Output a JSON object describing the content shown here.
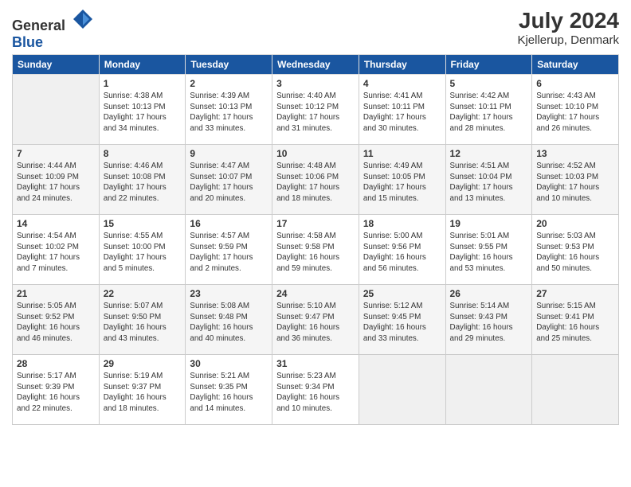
{
  "header": {
    "logo_general": "General",
    "logo_blue": "Blue",
    "title": "July 2024",
    "location": "Kjellerup, Denmark"
  },
  "days_of_week": [
    "Sunday",
    "Monday",
    "Tuesday",
    "Wednesday",
    "Thursday",
    "Friday",
    "Saturday"
  ],
  "weeks": [
    [
      {
        "day": "",
        "info": ""
      },
      {
        "day": "1",
        "info": "Sunrise: 4:38 AM\nSunset: 10:13 PM\nDaylight: 17 hours\nand 34 minutes."
      },
      {
        "day": "2",
        "info": "Sunrise: 4:39 AM\nSunset: 10:13 PM\nDaylight: 17 hours\nand 33 minutes."
      },
      {
        "day": "3",
        "info": "Sunrise: 4:40 AM\nSunset: 10:12 PM\nDaylight: 17 hours\nand 31 minutes."
      },
      {
        "day": "4",
        "info": "Sunrise: 4:41 AM\nSunset: 10:11 PM\nDaylight: 17 hours\nand 30 minutes."
      },
      {
        "day": "5",
        "info": "Sunrise: 4:42 AM\nSunset: 10:11 PM\nDaylight: 17 hours\nand 28 minutes."
      },
      {
        "day": "6",
        "info": "Sunrise: 4:43 AM\nSunset: 10:10 PM\nDaylight: 17 hours\nand 26 minutes."
      }
    ],
    [
      {
        "day": "7",
        "info": "Sunrise: 4:44 AM\nSunset: 10:09 PM\nDaylight: 17 hours\nand 24 minutes."
      },
      {
        "day": "8",
        "info": "Sunrise: 4:46 AM\nSunset: 10:08 PM\nDaylight: 17 hours\nand 22 minutes."
      },
      {
        "day": "9",
        "info": "Sunrise: 4:47 AM\nSunset: 10:07 PM\nDaylight: 17 hours\nand 20 minutes."
      },
      {
        "day": "10",
        "info": "Sunrise: 4:48 AM\nSunset: 10:06 PM\nDaylight: 17 hours\nand 18 minutes."
      },
      {
        "day": "11",
        "info": "Sunrise: 4:49 AM\nSunset: 10:05 PM\nDaylight: 17 hours\nand 15 minutes."
      },
      {
        "day": "12",
        "info": "Sunrise: 4:51 AM\nSunset: 10:04 PM\nDaylight: 17 hours\nand 13 minutes."
      },
      {
        "day": "13",
        "info": "Sunrise: 4:52 AM\nSunset: 10:03 PM\nDaylight: 17 hours\nand 10 minutes."
      }
    ],
    [
      {
        "day": "14",
        "info": "Sunrise: 4:54 AM\nSunset: 10:02 PM\nDaylight: 17 hours\nand 7 minutes."
      },
      {
        "day": "15",
        "info": "Sunrise: 4:55 AM\nSunset: 10:00 PM\nDaylight: 17 hours\nand 5 minutes."
      },
      {
        "day": "16",
        "info": "Sunrise: 4:57 AM\nSunset: 9:59 PM\nDaylight: 17 hours\nand 2 minutes."
      },
      {
        "day": "17",
        "info": "Sunrise: 4:58 AM\nSunset: 9:58 PM\nDaylight: 16 hours\nand 59 minutes."
      },
      {
        "day": "18",
        "info": "Sunrise: 5:00 AM\nSunset: 9:56 PM\nDaylight: 16 hours\nand 56 minutes."
      },
      {
        "day": "19",
        "info": "Sunrise: 5:01 AM\nSunset: 9:55 PM\nDaylight: 16 hours\nand 53 minutes."
      },
      {
        "day": "20",
        "info": "Sunrise: 5:03 AM\nSunset: 9:53 PM\nDaylight: 16 hours\nand 50 minutes."
      }
    ],
    [
      {
        "day": "21",
        "info": "Sunrise: 5:05 AM\nSunset: 9:52 PM\nDaylight: 16 hours\nand 46 minutes."
      },
      {
        "day": "22",
        "info": "Sunrise: 5:07 AM\nSunset: 9:50 PM\nDaylight: 16 hours\nand 43 minutes."
      },
      {
        "day": "23",
        "info": "Sunrise: 5:08 AM\nSunset: 9:48 PM\nDaylight: 16 hours\nand 40 minutes."
      },
      {
        "day": "24",
        "info": "Sunrise: 5:10 AM\nSunset: 9:47 PM\nDaylight: 16 hours\nand 36 minutes."
      },
      {
        "day": "25",
        "info": "Sunrise: 5:12 AM\nSunset: 9:45 PM\nDaylight: 16 hours\nand 33 minutes."
      },
      {
        "day": "26",
        "info": "Sunrise: 5:14 AM\nSunset: 9:43 PM\nDaylight: 16 hours\nand 29 minutes."
      },
      {
        "day": "27",
        "info": "Sunrise: 5:15 AM\nSunset: 9:41 PM\nDaylight: 16 hours\nand 25 minutes."
      }
    ],
    [
      {
        "day": "28",
        "info": "Sunrise: 5:17 AM\nSunset: 9:39 PM\nDaylight: 16 hours\nand 22 minutes."
      },
      {
        "day": "29",
        "info": "Sunrise: 5:19 AM\nSunset: 9:37 PM\nDaylight: 16 hours\nand 18 minutes."
      },
      {
        "day": "30",
        "info": "Sunrise: 5:21 AM\nSunset: 9:35 PM\nDaylight: 16 hours\nand 14 minutes."
      },
      {
        "day": "31",
        "info": "Sunrise: 5:23 AM\nSunset: 9:34 PM\nDaylight: 16 hours\nand 10 minutes."
      },
      {
        "day": "",
        "info": ""
      },
      {
        "day": "",
        "info": ""
      },
      {
        "day": "",
        "info": ""
      }
    ]
  ]
}
